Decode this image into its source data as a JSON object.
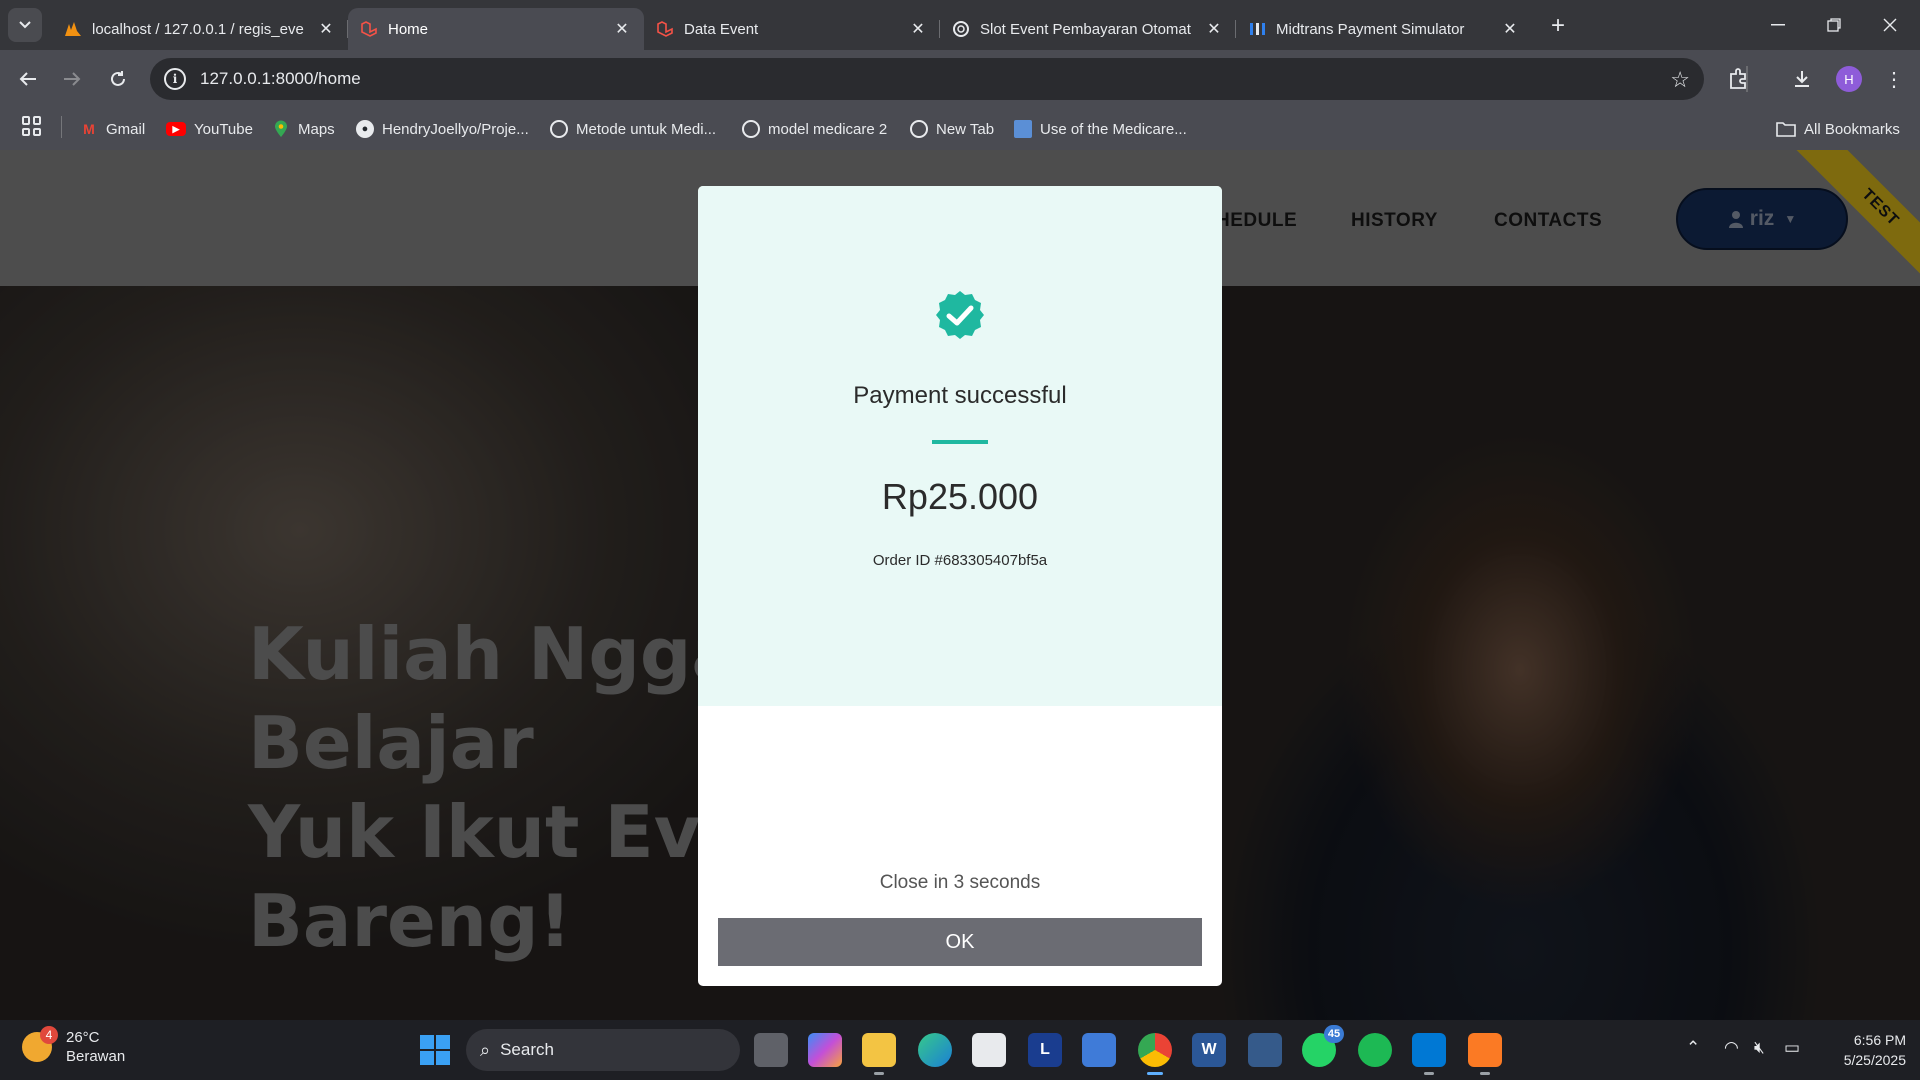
{
  "browser": {
    "tabs": [
      {
        "title": "localhost / 127.0.0.1 / regis_eve",
        "icon": "phpmyadmin-icon",
        "active": false
      },
      {
        "title": "Home",
        "icon": "laravel-icon",
        "active": true
      },
      {
        "title": "Data Event",
        "icon": "laravel-icon",
        "active": false
      },
      {
        "title": "Slot Event Pembayaran Otomat",
        "icon": "openai-icon",
        "active": false
      },
      {
        "title": "Midtrans Payment Simulator",
        "icon": "midtrans-icon",
        "active": false
      }
    ],
    "url": "127.0.0.1:8000/home",
    "profile_initial": "H",
    "bookmarks": [
      {
        "label": "Gmail",
        "icon": "gmail-icon"
      },
      {
        "label": "YouTube",
        "icon": "youtube-icon"
      },
      {
        "label": "Maps",
        "icon": "maps-icon"
      },
      {
        "label": "HendryJoellyo/Proje...",
        "icon": "github-icon"
      },
      {
        "label": "Metode untuk Medi...",
        "icon": "globe-icon"
      },
      {
        "label": "model medicare 2",
        "icon": "globe-icon"
      },
      {
        "label": "New Tab",
        "icon": "globe-icon"
      },
      {
        "label": "Use of the Medicare...",
        "icon": "doc-icon"
      }
    ],
    "all_bookmarks_label": "All Bookmarks"
  },
  "site": {
    "nav": {
      "schedule_partial": "HEDULE",
      "history": "HISTORY",
      "contacts": "CONTACTS",
      "user": "riz"
    },
    "test_ribbon": "TEST",
    "headline": [
      "Kuliah Nggal",
      "Belajar",
      "Yuk Ikut Eve",
      "Bareng!"
    ]
  },
  "modal": {
    "title": "Payment successful",
    "amount": "Rp25.000",
    "order_id": "Order ID #683305407bf5a",
    "countdown": "Close in 3 seconds",
    "ok_label": "OK",
    "accent_color": "#1fb8a0"
  },
  "taskbar": {
    "weather": {
      "temp": "26°C",
      "condition": "Berawan",
      "badge": "4"
    },
    "search_label": "Search",
    "apps": [
      {
        "name": "task-view-icon"
      },
      {
        "name": "copilot-icon"
      },
      {
        "name": "file-explorer-icon"
      },
      {
        "name": "edge-icon"
      },
      {
        "name": "microsoft-store-icon"
      },
      {
        "name": "l-app-icon",
        "label": "L"
      },
      {
        "name": "pen-app-icon"
      },
      {
        "name": "chrome-icon"
      },
      {
        "name": "word-icon",
        "label": "W"
      },
      {
        "name": "sql-app-icon"
      },
      {
        "name": "whatsapp-icon",
        "badge": "45"
      },
      {
        "name": "spotify-icon"
      },
      {
        "name": "vscode-icon"
      },
      {
        "name": "xampp-icon"
      }
    ],
    "time": "6:56 PM",
    "date": "5/25/2025"
  }
}
